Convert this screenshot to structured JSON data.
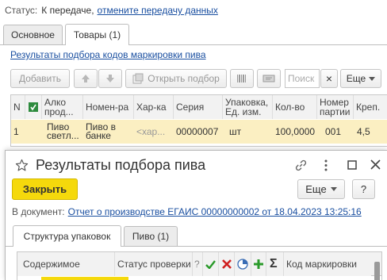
{
  "status": {
    "label": "Статус:",
    "value": "К передаче,",
    "cancel_link": "отмените передачу данных"
  },
  "tabs": [
    {
      "label": "Основное"
    },
    {
      "label": "Товары (1)"
    }
  ],
  "marking_link": "Результаты подбора кодов маркировки пива",
  "toolbar": {
    "add_label": "Добавить",
    "open_selection_label": "Открыть подбор",
    "search_placeholder": "Поиск",
    "clear_label": "×",
    "more_label": "Еще"
  },
  "goods_table": {
    "columns": [
      "N",
      "Алко прод...",
      "Номен-ра",
      "Хар-ка",
      "Серия",
      "Упаковка, Ед. изм.",
      "Кол-во",
      "Номер партии",
      "Креп."
    ],
    "row": {
      "n": "1",
      "alco": "Пиво светл...",
      "nomen": "Пиво в банке",
      "char": "<хар...",
      "series": "00000007",
      "unit": "шт",
      "qty": "100,0000",
      "batch": "001",
      "strength": "4,5"
    }
  },
  "dialog": {
    "title": "Результаты подбора пива",
    "close_label": "Закрыть",
    "more_label": "Еще",
    "help_label": "?",
    "doc_label": "В документ:",
    "doc_link": "Отчет о производстве ЕГАИС 00000000002 от 18.04.2023 13:25:16",
    "tabs": [
      {
        "label": "Структура упаковок"
      },
      {
        "label": "Пиво (1)"
      }
    ],
    "table_columns": {
      "content": "Содержимое",
      "status": "Статус проверки",
      "question": "?",
      "code": "Код маркировки"
    }
  },
  "colors": {
    "accent_yellow": "#f5d90c",
    "row_highlight": "#fbefc2",
    "link_blue": "#1a4fa0",
    "green_check": "#2a9a2a",
    "red_cross": "#d02020"
  }
}
